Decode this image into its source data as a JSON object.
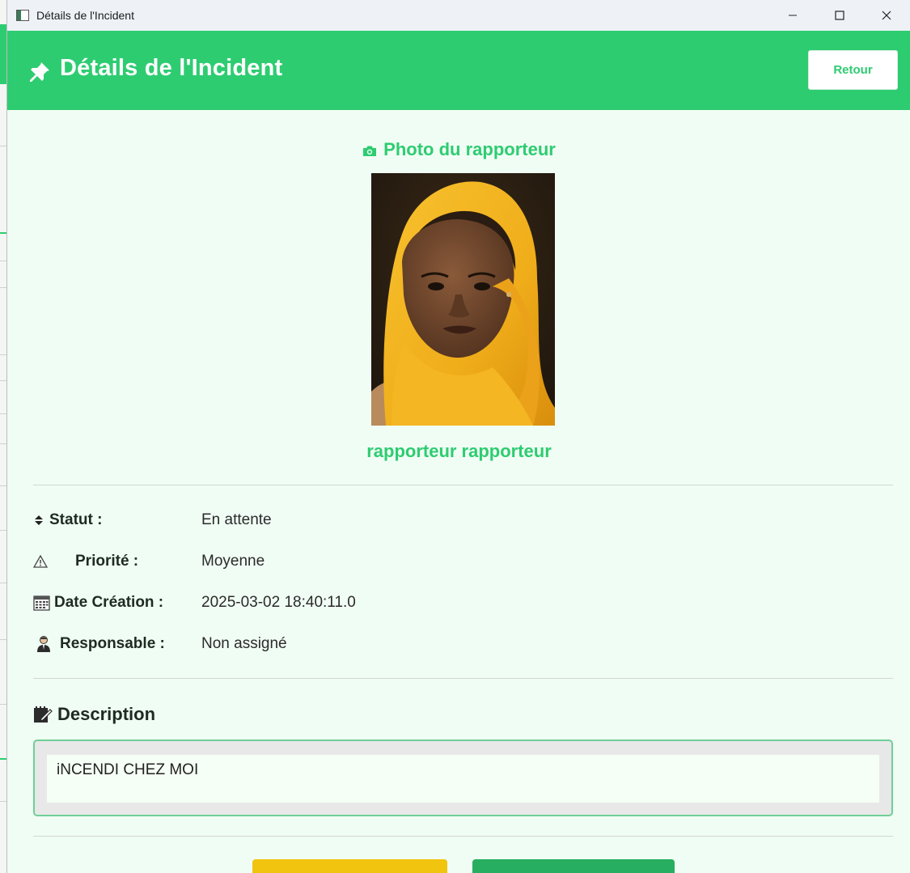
{
  "window": {
    "title": "Détails de l'Incident",
    "controls": [
      "minimize-icon",
      "maximize-icon",
      "close-icon"
    ]
  },
  "header": {
    "icon": "pushpin-icon",
    "title": "Détails de l'Incident",
    "back_button": "Retour"
  },
  "reporter": {
    "section_icon": "camera-icon",
    "section_title": "Photo du rapporteur",
    "name": "rapporteur rapporteur"
  },
  "details": [
    {
      "icon": "up-down-arrow-icon",
      "label": "Statut :",
      "value": "En attente"
    },
    {
      "icon": "warning-icon",
      "label": "Priorité :",
      "value": "Moyenne"
    },
    {
      "icon": "calendar-icon",
      "label": "Date Création :",
      "value": "2025-03-02 18:40:11.0"
    },
    {
      "icon": "person-icon",
      "label": "Responsable :",
      "value": "Non assigné"
    }
  ],
  "description": {
    "icon": "memo-icon",
    "title": "Description",
    "text": "iNCENDI CHEZ MOI"
  },
  "colors": {
    "primary": "#2ecc71",
    "background": "#f0fdf4",
    "button_yellow": "#f1c40f",
    "button_green": "#27ae60"
  }
}
